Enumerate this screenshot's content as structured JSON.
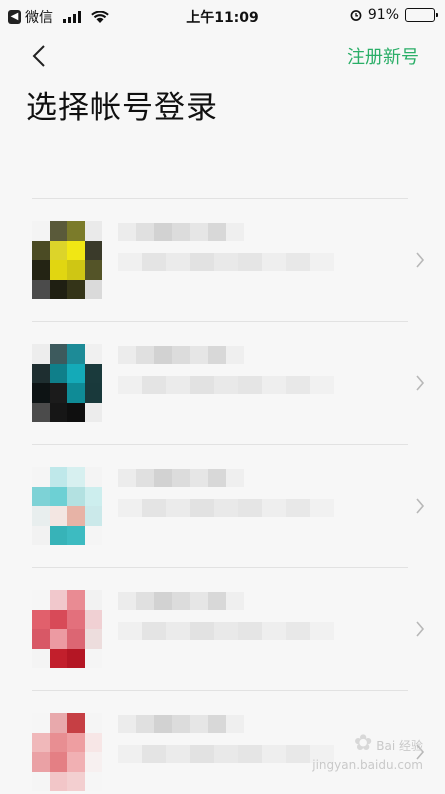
{
  "status_bar": {
    "back_app_label": "微信",
    "time": "上午11:09",
    "battery": "91%",
    "battery_level": 0.91
  },
  "nav": {
    "register_label": "注册新号"
  },
  "title": "选择帐号登录",
  "accounts": [
    {
      "avatar_colors": [
        "#f4f4f4",
        "#5a5a3a",
        "#7b7b2a",
        "#eaeaea",
        "#4b4b24",
        "#dcd42a",
        "#f1e714",
        "#3a3a2a",
        "#242414",
        "#e1d611",
        "#cfc614",
        "#545428",
        "#4b4b4b",
        "#1f1f12",
        "#343418",
        "#dadada"
      ]
    },
    {
      "avatar_colors": [
        "#ededed",
        "#3d5a5d",
        "#1d8b97",
        "#f0f0f0",
        "#1e2e30",
        "#0f7f8a",
        "#14aab8",
        "#1a3a3c",
        "#0d1314",
        "#1b1b1b",
        "#0f8b96",
        "#19393b",
        "#4b4b4b",
        "#161616",
        "#0f0f0f",
        "#ececec"
      ]
    },
    {
      "avatar_colors": [
        "#f5f5f5",
        "#bfe8ea",
        "#d7f0f0",
        "#f4f4f4",
        "#7dd2d6",
        "#6dd0d4",
        "#b3e1e1",
        "#cdeeee",
        "#e8eeee",
        "#f3e6e2",
        "#e7b3a6",
        "#cbe9ea",
        "#f2f2f2",
        "#37b3b8",
        "#3dbbc1",
        "#f5f5f5"
      ]
    },
    {
      "avatar_colors": [
        "#f6f6f6",
        "#f1c8cc",
        "#e98b93",
        "#f2f2f2",
        "#e1606c",
        "#d84a58",
        "#e3707c",
        "#f0d0d3",
        "#d85866",
        "#ec9aa2",
        "#dc6673",
        "#eddddd",
        "#f4f4f4",
        "#c21f2c",
        "#b41624",
        "#f5f5f5"
      ]
    },
    {
      "avatar_colors": [
        "#f6f6f6",
        "#e8a9ac",
        "#c63f44",
        "#f5f5f5",
        "#f0b8ba",
        "#e88e92",
        "#ee9ea1",
        "#f7e6e6",
        "#eaa1a5",
        "#e47f84",
        "#f1b0b3",
        "#f7f0f0",
        "#f5f5f5",
        "#f2c6c8",
        "#f3cfd0",
        "#f6f6f6"
      ]
    }
  ],
  "watermark": {
    "line1": "Bai 经验",
    "line2": "jingyan.baidu.com"
  },
  "colors": {
    "accent": "#2aae67",
    "background": "#f7f7f7",
    "divider": "#e2e2e2"
  }
}
